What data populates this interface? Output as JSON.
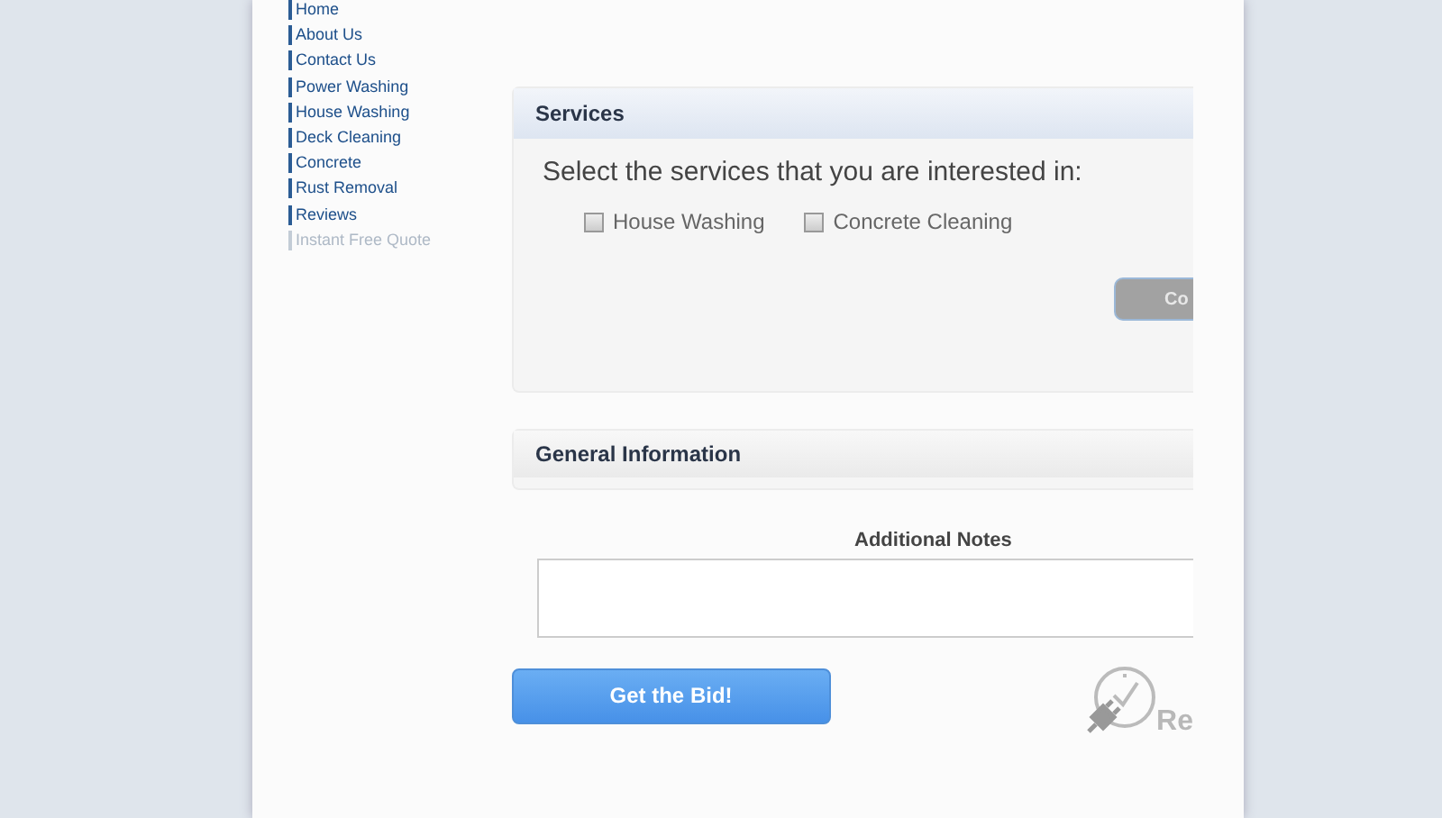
{
  "nav": [
    {
      "label": "Home",
      "disabled": false
    },
    {
      "label": "About Us",
      "disabled": false
    },
    {
      "label": "Contact Us",
      "disabled": false
    },
    {
      "label": "Power Washing",
      "disabled": false
    },
    {
      "label": "House Washing",
      "disabled": false
    },
    {
      "label": "Deck Cleaning",
      "disabled": false
    },
    {
      "label": "Concrete",
      "disabled": false
    },
    {
      "label": "Rust Removal",
      "disabled": false
    },
    {
      "label": "Reviews",
      "disabled": false
    },
    {
      "label": "Instant Free Quote",
      "disabled": true
    }
  ],
  "services": {
    "title": "Services",
    "prompt": "Select the services that you are interested in:",
    "options": [
      {
        "label": "House Washing",
        "checked": false
      },
      {
        "label": "Concrete Cleaning",
        "checked": false
      }
    ],
    "button": "Co"
  },
  "general": {
    "title": "General Information"
  },
  "notes": {
    "label": "Additional Notes"
  },
  "submit": "Get the Bid!",
  "logo": {
    "text": "Re"
  }
}
